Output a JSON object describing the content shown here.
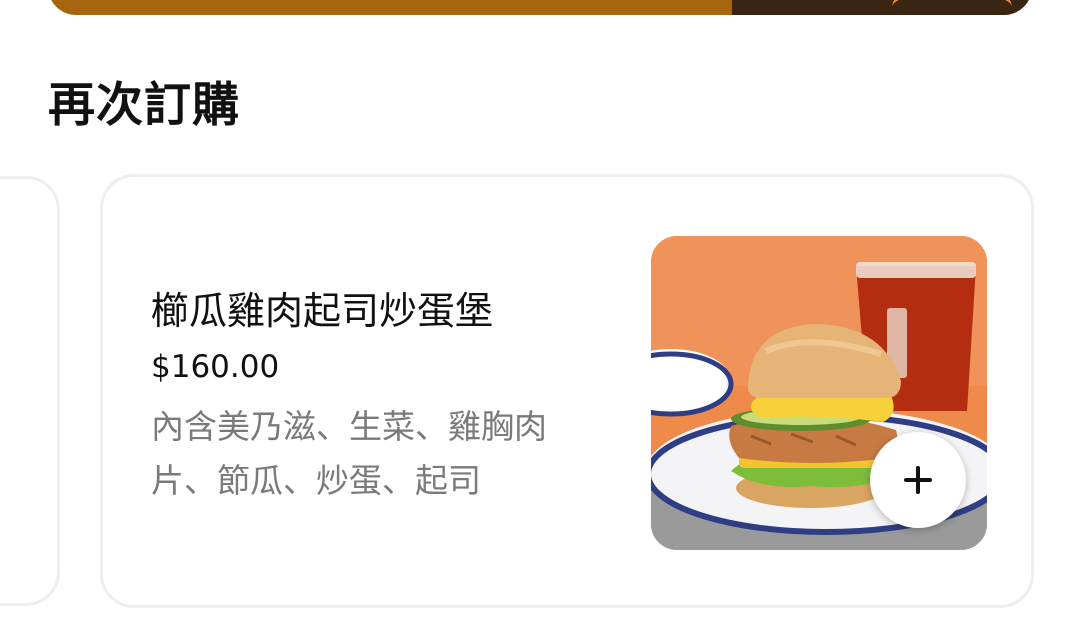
{
  "section": {
    "title": "再次訂購"
  },
  "item": {
    "name": "櫛瓜雞肉起司炒蛋堡",
    "price": "$160.00",
    "description": "內含美乃滋、生菜、雞胸肉片、節瓜、炒蛋、起司",
    "image": "burger-photo",
    "add_icon": "plus-icon"
  },
  "colors": {
    "banner": "#a7650e",
    "banner_dark": "#3a2412",
    "title_text": "#111111",
    "description_text": "#7a7a7a",
    "card_border": "#eeeeee"
  }
}
